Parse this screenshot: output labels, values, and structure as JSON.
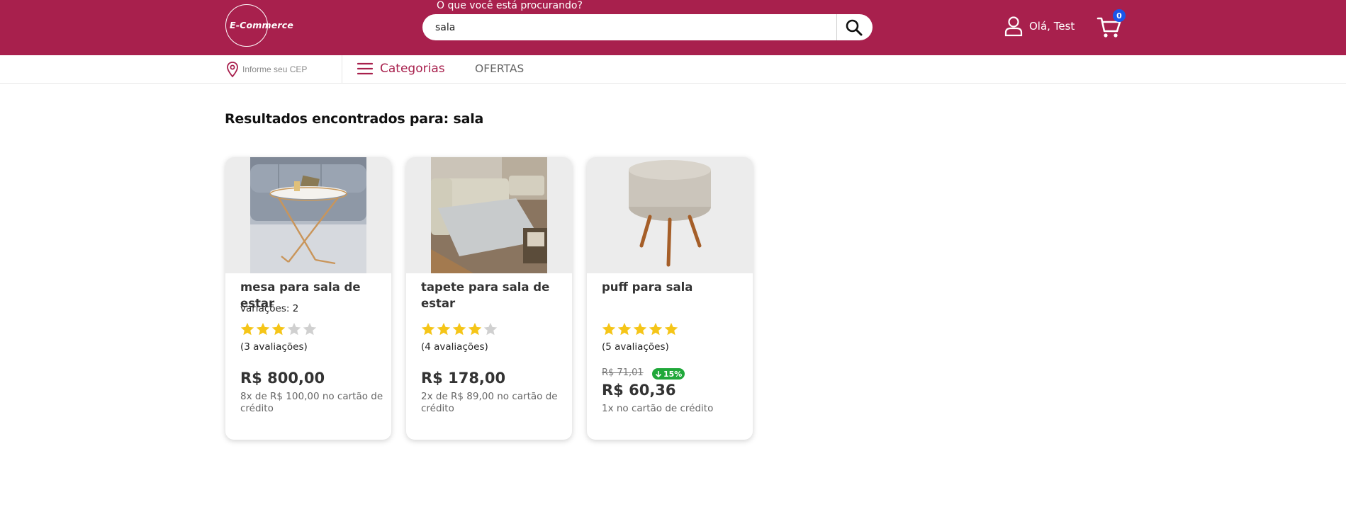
{
  "header": {
    "logo_text": "E-Commerce",
    "search_label": "O que você está procurando?",
    "search_value": "sala",
    "greeting": "Olá, Test",
    "cart_count": "0",
    "bg_color": "#a8204d"
  },
  "subnav": {
    "cep_placeholder": "Informe seu CEP",
    "categories_label": "Categorias",
    "offers_label": "OFERTAS"
  },
  "results": {
    "title": "Resultados encontrados para: sala"
  },
  "products": [
    {
      "name": "mesa para sala de estar",
      "variations": "variações: 2",
      "rating": 3,
      "reviews": "(3 avaliações)",
      "price": "R$ 800,00",
      "installments": "8x de R$ 100,00 no cartão de crédito"
    },
    {
      "name": "tapete para sala de estar",
      "rating": 4,
      "reviews": "(4 avaliações)",
      "price": "R$ 178,00",
      "installments": "2x de R$ 89,00 no cartão de crédito"
    },
    {
      "name": "puff para sala",
      "rating": 5,
      "reviews": "(5 avaliações)",
      "old_price": "R$ 71,01",
      "discount": "15%",
      "price": "R$ 60,36",
      "installments": "1x no cartão de crédito"
    }
  ],
  "colors": {
    "star_on": "#f5c518",
    "star_off": "#d0d0d0",
    "discount": "#20a83a",
    "badge": "#1a56e8"
  }
}
